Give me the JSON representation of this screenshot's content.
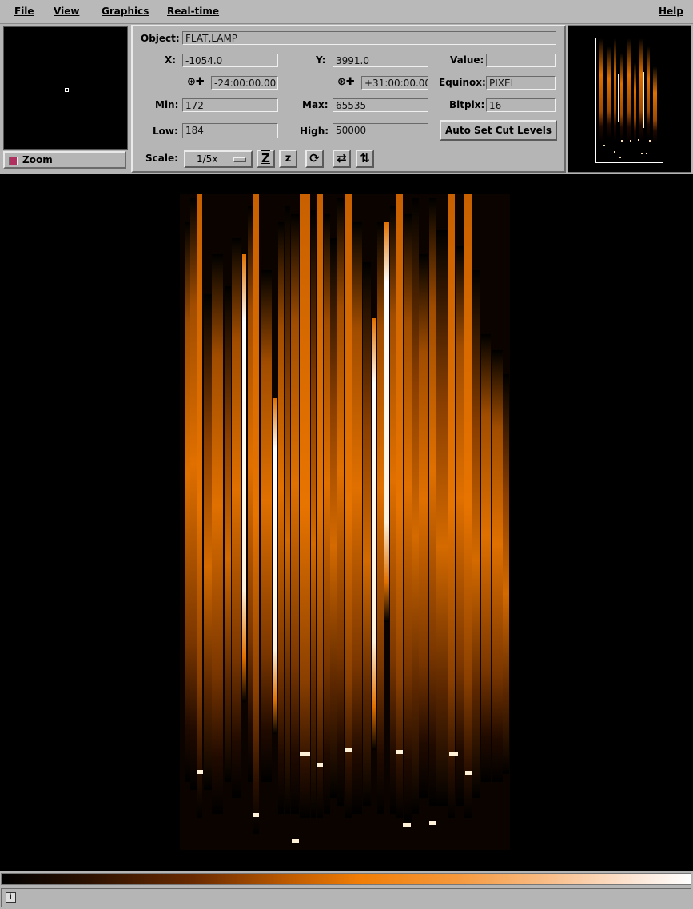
{
  "menu": {
    "file": "File",
    "view": "View",
    "graphics": "Graphics",
    "realtime": "Real-time",
    "help": "Help"
  },
  "zoom": {
    "label": "Zoom",
    "checked": true
  },
  "info": {
    "object_label": "Object:",
    "object_value": "FLAT,LAMP",
    "x_label": "X:",
    "x_value": "-1054.0",
    "y_label": "Y:",
    "y_value": "3991.0",
    "value_label": "Value:",
    "value_value": "",
    "ra_icon": "ra-crosshair-icon",
    "ra_value": "-24:00:00.000",
    "dec_icon": "dec-crosshair-icon",
    "dec_value": "+31:00:00.00",
    "equinox_label": "Equinox:",
    "equinox_value": "PIXEL",
    "min_label": "Min:",
    "min_value": "172",
    "max_label": "Max:",
    "max_value": "65535",
    "bitpix_label": "Bitpix:",
    "bitpix_value": "16",
    "low_label": "Low:",
    "low_value": "184",
    "high_label": "High:",
    "high_value": "50000",
    "auto_cut_label": "Auto Set Cut Levels",
    "scale_label": "Scale:",
    "scale_value": "1/5x"
  },
  "tools": {
    "zoom_in_glyph": "Z",
    "zoom_out_glyph": "z",
    "rotate_glyph": "⟳",
    "flip_x_glyph": "⇄",
    "flip_y_glyph": "⇅"
  },
  "colors": {
    "accent": "#f07d06",
    "background": "#b5b5b5"
  },
  "status": {
    "icon": "info-icon",
    "glyph": "i",
    "text": ""
  }
}
